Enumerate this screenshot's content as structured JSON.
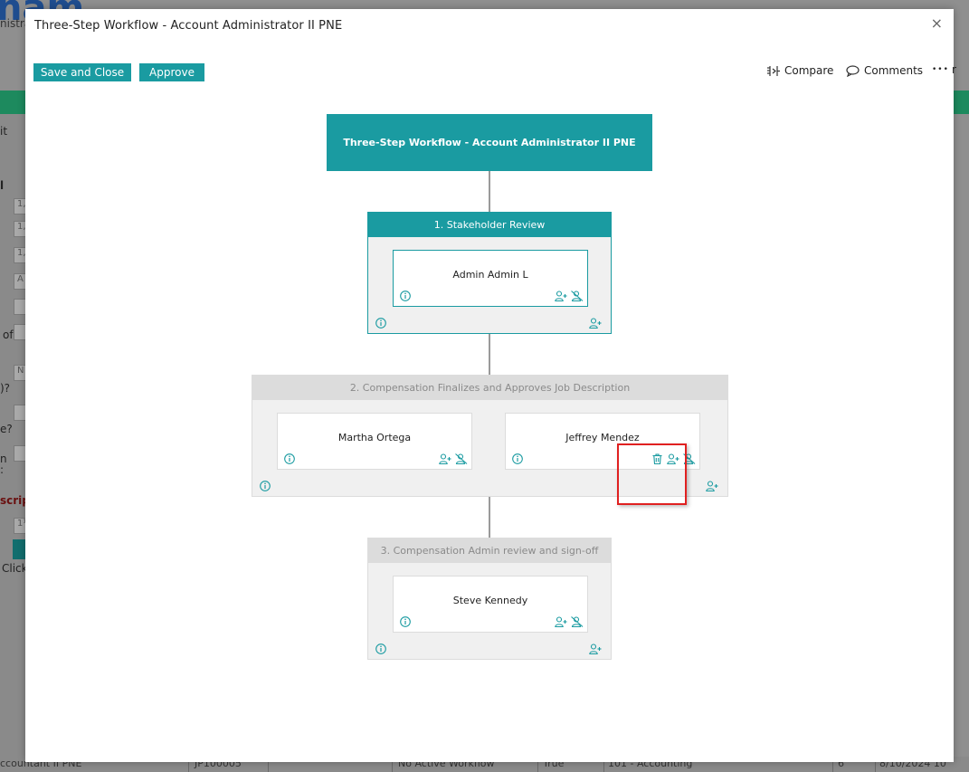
{
  "background": {
    "logo_fragment": "nam",
    "subtitle_fragment": "nistra",
    "side_labels": [
      "it",
      "l",
      "of",
      ")?",
      "e?",
      "n",
      ":",
      "script",
      "Click"
    ],
    "side_inputs": [
      "1,",
      "1,",
      "1,",
      "A",
      "",
      "",
      "N",
      "",
      "",
      "1¹"
    ],
    "footer": {
      "job": "ccountant II PNE",
      "code": "JP100005",
      "workflow": "No Active Workflow",
      "flag": "True",
      "department": "101 - Accounting",
      "count": "6",
      "date": "8/10/2024 10"
    }
  },
  "modal": {
    "title": "Three-Step Workflow - Account Administrator II PNE",
    "close_label": "×",
    "toolbar": {
      "save_close_label": "Save and Close",
      "approve_label": "Approve",
      "compare_label": "Compare",
      "comments_label": "Comments",
      "more_label": "•••",
      "more_suffix": "r"
    }
  },
  "workflow": {
    "root_title": "Three-Step Workflow - Account Administrator II PNE",
    "steps": [
      {
        "label": "1. Stakeholder Review",
        "active": true,
        "assignees": [
          "Admin Admin L"
        ]
      },
      {
        "label": "2. Compensation Finalizes and Approves Job Description",
        "active": false,
        "assignees": [
          "Martha Ortega",
          "Jeffrey Mendez"
        ]
      },
      {
        "label": "3. Compensation Admin review and sign-off",
        "active": false,
        "assignees": [
          "Steve Kennedy"
        ]
      }
    ]
  },
  "colors": {
    "accent": "#1a9ba1",
    "inactive_header": "#dcdcdc",
    "highlight": "#e02020",
    "overlay": "#8f8f8f"
  },
  "icons": [
    "info-icon",
    "add-person-icon",
    "remove-person-icon",
    "trash-icon",
    "compare-icon",
    "comment-icon",
    "more-icon",
    "close-icon"
  ]
}
